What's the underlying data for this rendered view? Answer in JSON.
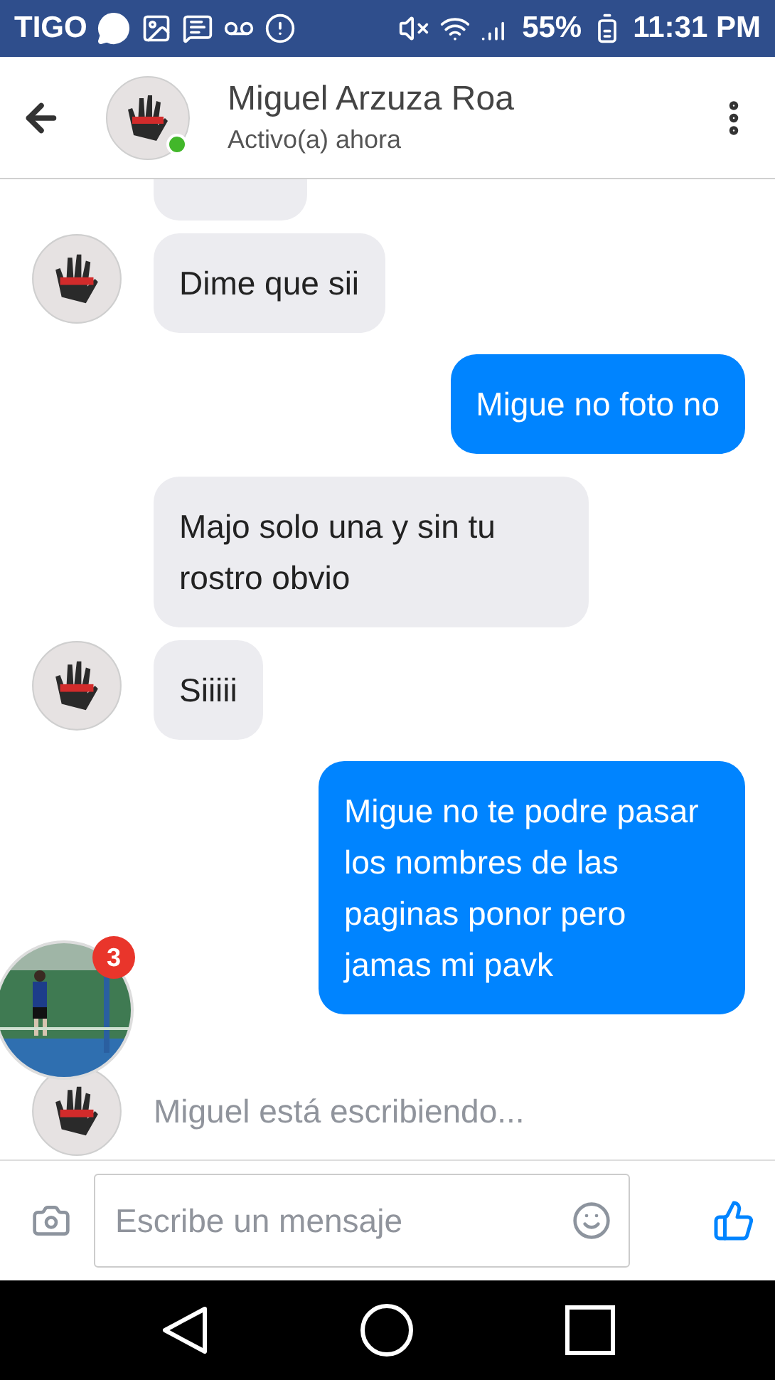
{
  "status_bar": {
    "carrier": "TIGO",
    "battery": "55%",
    "time": "11:31 PM"
  },
  "header": {
    "name": "Miguel Arzuza Roa",
    "status": "Activo(a) ahora",
    "online": true
  },
  "messages": [
    {
      "kind": "partial",
      "outgoing": false
    },
    {
      "kind": "text",
      "outgoing": false,
      "avatar": true,
      "text": "Dime que sii"
    },
    {
      "kind": "text",
      "outgoing": true,
      "text": "Migue no foto no"
    },
    {
      "kind": "text",
      "outgoing": false,
      "avatar": false,
      "text": "Majo solo una y sin tu rostro obvio"
    },
    {
      "kind": "text",
      "outgoing": false,
      "avatar": true,
      "text": "Siiiii"
    },
    {
      "kind": "text",
      "outgoing": true,
      "text": "Migue no te podre pasar los nombres de las paginas ponor pero jamas mi pavk"
    }
  ],
  "typing": {
    "text": "Miguel está escribiendo..."
  },
  "chat_head": {
    "badge": "3"
  },
  "composer": {
    "placeholder": "Escribe un mensaje"
  }
}
